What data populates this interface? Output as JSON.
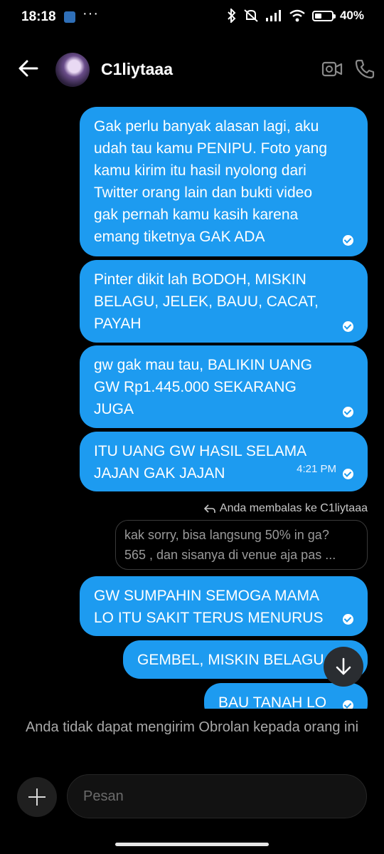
{
  "status_bar": {
    "time": "18:18",
    "more_dots": "···",
    "battery_percent": "40%",
    "battery_level": 0.4
  },
  "header": {
    "contact_name": "C1liytaaa"
  },
  "messages": [
    {
      "lines": [
        "Gak perlu banyak alasan lagi, aku",
        "udah tau kamu PENIPU. Foto yang",
        "kamu kirim itu hasil nyolong dari",
        "Twitter orang lain dan bukti video",
        "gak pernah kamu kasih karena",
        "emang tiketnya GAK ADA"
      ]
    },
    {
      "lines": [
        "Pinter dikit lah BODOH, MISKIN",
        "BELAGU, JELEK, BAUU, CACAT,",
        "PAYAH"
      ]
    },
    {
      "lines": [
        "gw  gak mau tau, BALIKIN UANG",
        "GW Rp1.445.000 SEKARANG",
        "JUGA"
      ]
    },
    {
      "lines": [
        "ITU UANG GW HASIL SELAMA",
        "JAJAN GAK JAJAN"
      ],
      "time": "4:21 PM"
    },
    {
      "lines": [
        "GW SUMPAHIN SEMOGA MAMA",
        "LO ITU SAKIT TERUS MENURUS"
      ]
    },
    {
      "lines": [
        "GEMBEL, MISKIN BELAGU"
      ]
    },
    {
      "lines": [
        "BAU TANAH LO"
      ]
    }
  ],
  "reply": {
    "note": "Anda membalas ke C1liytaaa",
    "quoted_lines": [
      "kak sorry, bisa langsung 50% in ga?",
      "565 , dan sisanya di venue aja pas ..."
    ]
  },
  "footer": {
    "blocked_message": "Anda tidak dapat mengirim Obrolan kepada orang ini",
    "input_placeholder": "Pesan"
  },
  "colors": {
    "bubble": "#1d9bf0",
    "background": "#000000"
  }
}
